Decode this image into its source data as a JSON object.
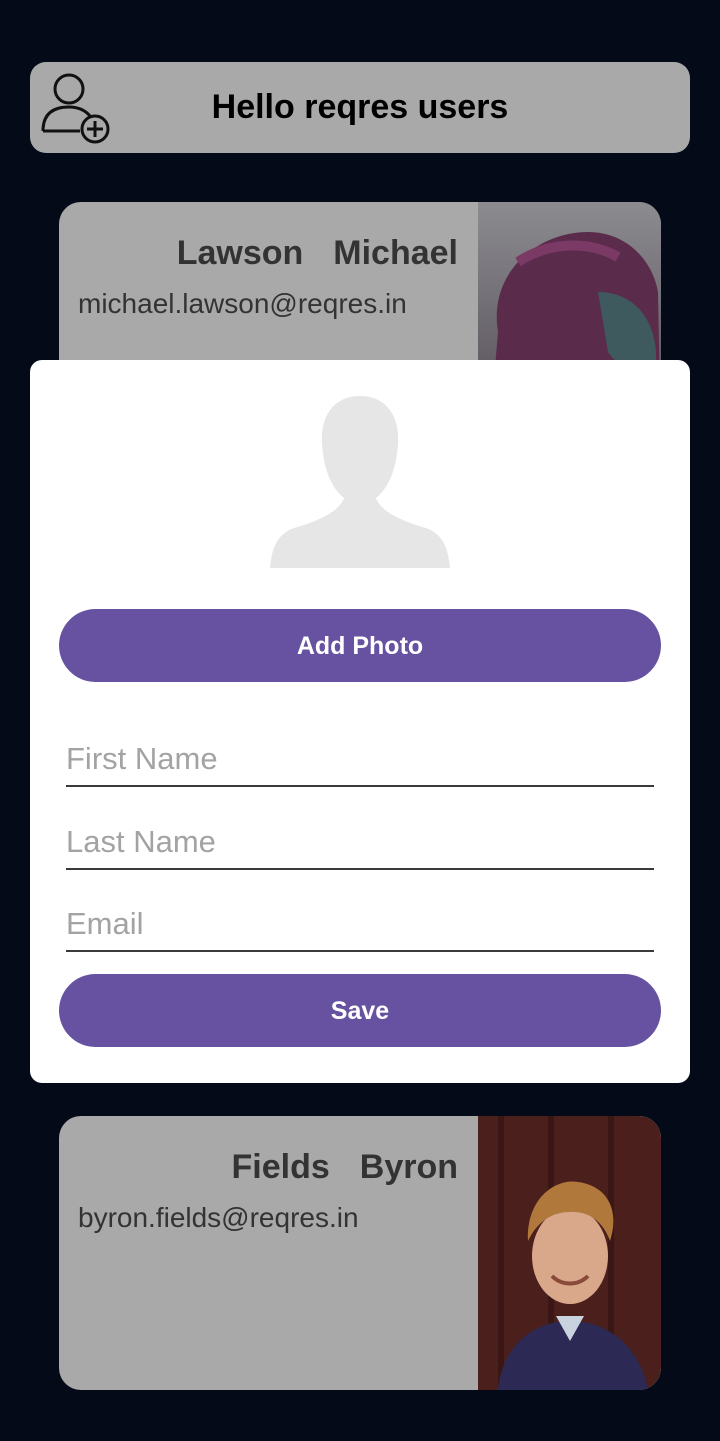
{
  "header": {
    "title": "Hello reqres users",
    "add_user_icon": "person-add-icon"
  },
  "users": [
    {
      "last_name": "Lawson",
      "first_name": "Michael",
      "email": "michael.lawson@reqres.in"
    },
    {
      "last_name": "Fields",
      "first_name": "Byron",
      "email": "byron.fields@reqres.in"
    }
  ],
  "dialog": {
    "avatar_icon": "person-silhouette-icon",
    "add_photo_label": "Add Photo",
    "first_name_placeholder": "First Name",
    "last_name_placeholder": "Last Name",
    "email_placeholder": "Email",
    "save_label": "Save"
  },
  "colors": {
    "background": "#040a18",
    "card": "#a9a9a9",
    "accent": "#6652a1",
    "dialog": "#ffffff"
  }
}
